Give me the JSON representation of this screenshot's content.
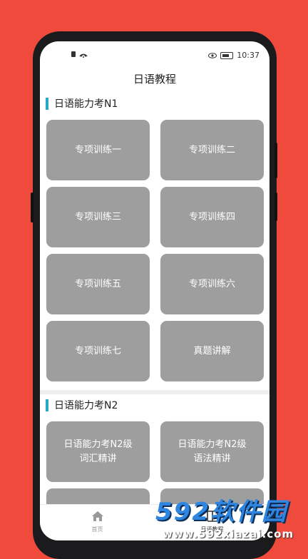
{
  "status_bar": {
    "left": "🔕 ☰",
    "time": "10:37"
  },
  "app_bar": {
    "title": "日语教程"
  },
  "sections": [
    {
      "title": "日语能力考N1",
      "items": [
        "专项训练一",
        "专项训练二",
        "专项训练三",
        "专项训练四",
        "专项训练五",
        "专项训练六",
        "专项训练七",
        "真题讲解"
      ]
    },
    {
      "title": "日语能力考N2",
      "items": [
        "日语能力考N2级\n词汇精讲",
        "日语能力考N2级\n语法精讲",
        "",
        ""
      ]
    }
  ],
  "tabs": [
    {
      "label": "首页",
      "icon": "home-icon"
    },
    {
      "label": "日语教程",
      "icon": "book-icon"
    }
  ],
  "watermark": {
    "logo": "592软件园",
    "url": "www.592xiazai.com"
  },
  "colors": {
    "background": "#f04a3c",
    "card": "#9e9e9e",
    "section_bar": "#2aa6c8"
  }
}
